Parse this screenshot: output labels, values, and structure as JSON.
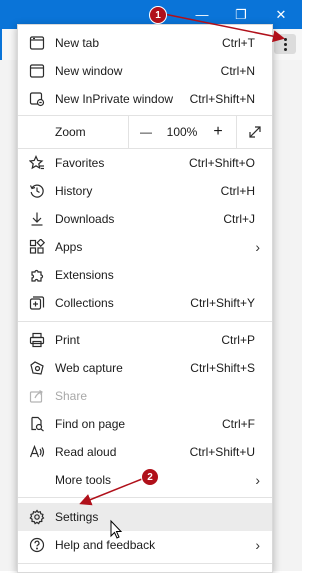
{
  "window": {
    "minimize_glyph": "—",
    "restore_glyph": "❐",
    "close_glyph": "✕"
  },
  "menu": {
    "items": [
      {
        "label": "New tab",
        "shortcut": "Ctrl+T",
        "icon": "new-tab-icon"
      },
      {
        "label": "New window",
        "shortcut": "Ctrl+N",
        "icon": "new-window-icon"
      },
      {
        "label": "New InPrivate window",
        "shortcut": "Ctrl+Shift+N",
        "icon": "inprivate-icon"
      },
      {
        "label": "Favorites",
        "shortcut": "Ctrl+Shift+O",
        "icon": "favorites-icon"
      },
      {
        "label": "History",
        "shortcut": "Ctrl+H",
        "icon": "history-icon"
      },
      {
        "label": "Downloads",
        "shortcut": "Ctrl+J",
        "icon": "download-icon"
      },
      {
        "label": "Apps",
        "shortcut": "",
        "icon": "apps-icon"
      },
      {
        "label": "Extensions",
        "shortcut": "",
        "icon": "extensions-icon"
      },
      {
        "label": "Collections",
        "shortcut": "Ctrl+Shift+Y",
        "icon": "collections-icon"
      },
      {
        "label": "Print",
        "shortcut": "Ctrl+P",
        "icon": "print-icon"
      },
      {
        "label": "Web capture",
        "shortcut": "Ctrl+Shift+S",
        "icon": "web-capture-icon"
      },
      {
        "label": "Share",
        "shortcut": "",
        "icon": "share-icon"
      },
      {
        "label": "Find on page",
        "shortcut": "Ctrl+F",
        "icon": "find-icon"
      },
      {
        "label": "Read aloud",
        "shortcut": "Ctrl+Shift+U",
        "icon": "read-aloud-icon"
      },
      {
        "label": "More tools",
        "shortcut": "",
        "icon": ""
      },
      {
        "label": "Settings",
        "shortcut": "",
        "icon": "gear-icon"
      },
      {
        "label": "Help and feedback",
        "shortcut": "",
        "icon": "help-icon"
      }
    ],
    "zoom": {
      "label": "Zoom",
      "value": "100%",
      "minus": "—",
      "plus": "+"
    }
  },
  "callouts": {
    "one": "1",
    "two": "2"
  },
  "colors": {
    "titlebar": "#0a74d8",
    "callout": "#b0101a"
  }
}
